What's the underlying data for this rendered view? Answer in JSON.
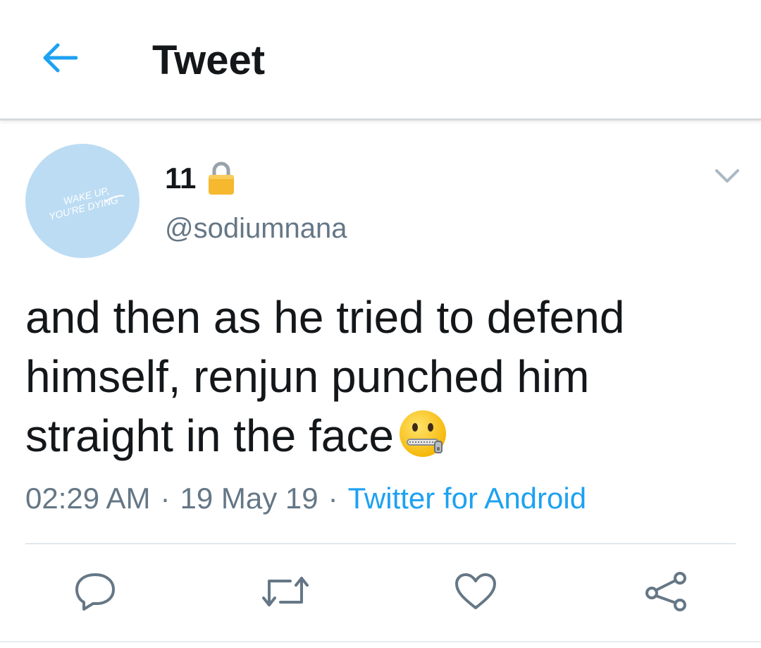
{
  "header": {
    "title": "Tweet",
    "back_icon": "arrow-left-icon",
    "accent_color": "#1da1f2"
  },
  "tweet": {
    "avatar": {
      "background": "#bcdcf3",
      "text_line1": "WAKE UP,",
      "text_line2": "YOU'RE DYING"
    },
    "display_name": "11",
    "protected_icon": "lock-icon",
    "handle": "@sodiumnana",
    "text": "and then as he tried to defend himself, renjun punched him straight in the face",
    "emoji_icon": "zipper-mouth-face-icon",
    "time": "02:29 AM",
    "date": "19 May 19",
    "separator": "·",
    "source": "Twitter for Android"
  },
  "actions": [
    {
      "name": "reply",
      "icon": "reply-icon"
    },
    {
      "name": "retweet",
      "icon": "retweet-icon"
    },
    {
      "name": "like",
      "icon": "heart-icon"
    },
    {
      "name": "share",
      "icon": "share-icon"
    }
  ],
  "colors": {
    "text_primary": "#14171a",
    "text_secondary": "#657786",
    "link": "#1da1f2",
    "divider": "#e1e8ed"
  }
}
